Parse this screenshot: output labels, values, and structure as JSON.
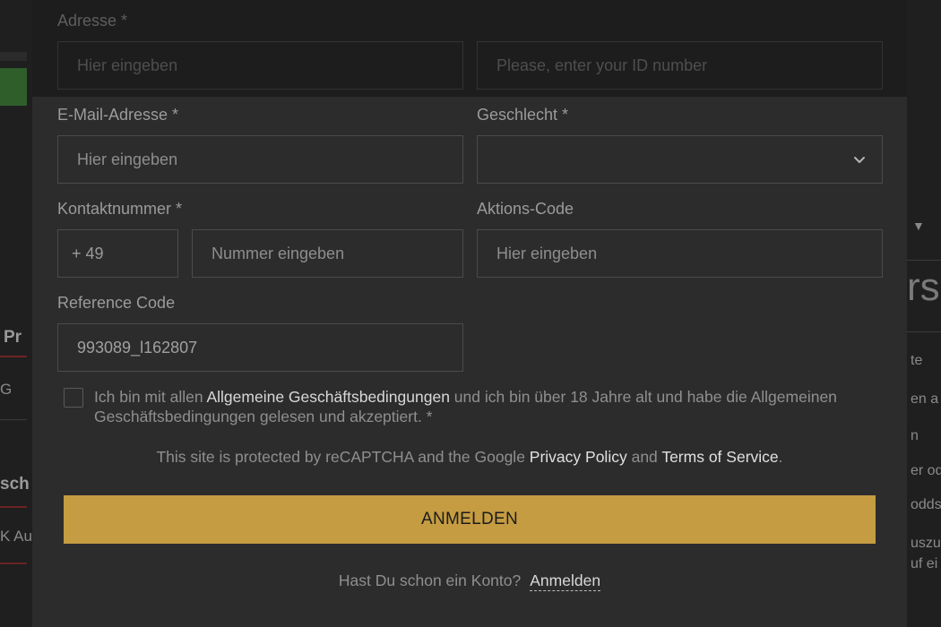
{
  "background": {
    "fragment_pr": "Pr",
    "fragment_g": "G",
    "fragment_sch": "sch",
    "fragment_k_au": "K Au",
    "fragment_rs": "rs",
    "right_lines": [
      "te",
      "en a",
      "n",
      "er od",
      "odds",
      "uszu",
      "uf ei"
    ]
  },
  "form_top": {
    "address_label": "Adresse *",
    "address_placeholder": "Hier eingeben",
    "id_placeholder": "Please, enter your ID number"
  },
  "form": {
    "email_label": "E-Mail-Adresse *",
    "email_placeholder": "Hier eingeben",
    "gender_label": "Geschlecht *",
    "gender_value": "",
    "phone_label": "Kontaktnummer *",
    "phone_prefix": "+ 49",
    "phone_placeholder": "Nummer eingeben",
    "promo_label": "Aktions-Code",
    "promo_placeholder": "Hier eingeben",
    "reference_label": "Reference Code",
    "reference_value": "993089_l162807"
  },
  "terms": {
    "text_before": "Ich bin mit allen ",
    "link": "Allgemeine Geschäftsbedingungen",
    "text_after": " und ich bin über 18 Jahre alt und habe die Allgemeinen Geschäftsbedingungen gelesen und akzeptiert. *"
  },
  "recaptcha": {
    "text_before": "This site is protected by reCAPTCHA and the Google ",
    "privacy_link": "Privacy Policy",
    "and": " and ",
    "terms_link": "Terms of Service",
    "period": "."
  },
  "submit_label": "ANMELDEN",
  "login_prompt": {
    "question": "Hast Du schon ein Konto?",
    "link": "Anmelden"
  },
  "colors": {
    "accent": "#c59c42",
    "modal_bg": "#2c2c2c"
  }
}
